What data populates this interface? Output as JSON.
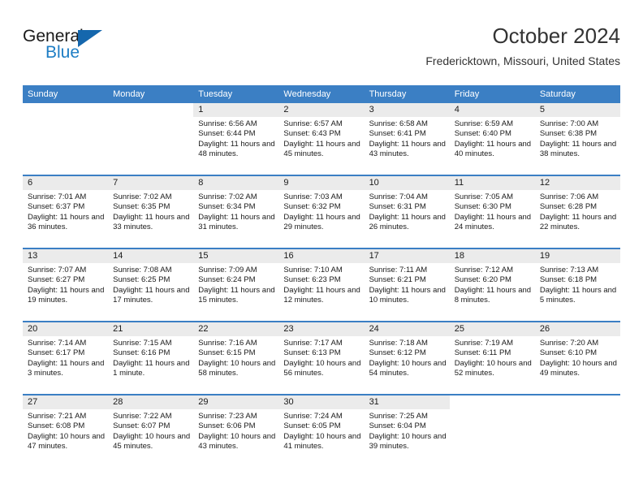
{
  "brand": {
    "name_top": "General",
    "name_bottom": "Blue",
    "triangle_icon": "triangle-icon",
    "accent_color": "#1567ad",
    "blue_text_color": "#1d7dc4"
  },
  "header": {
    "title": "October 2024",
    "subtitle": "Fredericktown, Missouri, United States"
  },
  "theme": {
    "header_row_bg": "#3b7fc4",
    "daynum_bg": "#ebebeb",
    "row_divider": "#3b7fc4",
    "text": "#1a1a1a"
  },
  "weekdays": [
    "Sunday",
    "Monday",
    "Tuesday",
    "Wednesday",
    "Thursday",
    "Friday",
    "Saturday"
  ],
  "weeks": [
    [
      {
        "day": "",
        "blank": true
      },
      {
        "day": "",
        "blank": true
      },
      {
        "day": "1",
        "sunrise": "Sunrise: 6:56 AM",
        "sunset": "Sunset: 6:44 PM",
        "daylight": "Daylight: 11 hours and 48 minutes."
      },
      {
        "day": "2",
        "sunrise": "Sunrise: 6:57 AM",
        "sunset": "Sunset: 6:43 PM",
        "daylight": "Daylight: 11 hours and 45 minutes."
      },
      {
        "day": "3",
        "sunrise": "Sunrise: 6:58 AM",
        "sunset": "Sunset: 6:41 PM",
        "daylight": "Daylight: 11 hours and 43 minutes."
      },
      {
        "day": "4",
        "sunrise": "Sunrise: 6:59 AM",
        "sunset": "Sunset: 6:40 PM",
        "daylight": "Daylight: 11 hours and 40 minutes."
      },
      {
        "day": "5",
        "sunrise": "Sunrise: 7:00 AM",
        "sunset": "Sunset: 6:38 PM",
        "daylight": "Daylight: 11 hours and 38 minutes."
      }
    ],
    [
      {
        "day": "6",
        "sunrise": "Sunrise: 7:01 AM",
        "sunset": "Sunset: 6:37 PM",
        "daylight": "Daylight: 11 hours and 36 minutes."
      },
      {
        "day": "7",
        "sunrise": "Sunrise: 7:02 AM",
        "sunset": "Sunset: 6:35 PM",
        "daylight": "Daylight: 11 hours and 33 minutes."
      },
      {
        "day": "8",
        "sunrise": "Sunrise: 7:02 AM",
        "sunset": "Sunset: 6:34 PM",
        "daylight": "Daylight: 11 hours and 31 minutes."
      },
      {
        "day": "9",
        "sunrise": "Sunrise: 7:03 AM",
        "sunset": "Sunset: 6:32 PM",
        "daylight": "Daylight: 11 hours and 29 minutes."
      },
      {
        "day": "10",
        "sunrise": "Sunrise: 7:04 AM",
        "sunset": "Sunset: 6:31 PM",
        "daylight": "Daylight: 11 hours and 26 minutes."
      },
      {
        "day": "11",
        "sunrise": "Sunrise: 7:05 AM",
        "sunset": "Sunset: 6:30 PM",
        "daylight": "Daylight: 11 hours and 24 minutes."
      },
      {
        "day": "12",
        "sunrise": "Sunrise: 7:06 AM",
        "sunset": "Sunset: 6:28 PM",
        "daylight": "Daylight: 11 hours and 22 minutes."
      }
    ],
    [
      {
        "day": "13",
        "sunrise": "Sunrise: 7:07 AM",
        "sunset": "Sunset: 6:27 PM",
        "daylight": "Daylight: 11 hours and 19 minutes."
      },
      {
        "day": "14",
        "sunrise": "Sunrise: 7:08 AM",
        "sunset": "Sunset: 6:25 PM",
        "daylight": "Daylight: 11 hours and 17 minutes."
      },
      {
        "day": "15",
        "sunrise": "Sunrise: 7:09 AM",
        "sunset": "Sunset: 6:24 PM",
        "daylight": "Daylight: 11 hours and 15 minutes."
      },
      {
        "day": "16",
        "sunrise": "Sunrise: 7:10 AM",
        "sunset": "Sunset: 6:23 PM",
        "daylight": "Daylight: 11 hours and 12 minutes."
      },
      {
        "day": "17",
        "sunrise": "Sunrise: 7:11 AM",
        "sunset": "Sunset: 6:21 PM",
        "daylight": "Daylight: 11 hours and 10 minutes."
      },
      {
        "day": "18",
        "sunrise": "Sunrise: 7:12 AM",
        "sunset": "Sunset: 6:20 PM",
        "daylight": "Daylight: 11 hours and 8 minutes."
      },
      {
        "day": "19",
        "sunrise": "Sunrise: 7:13 AM",
        "sunset": "Sunset: 6:18 PM",
        "daylight": "Daylight: 11 hours and 5 minutes."
      }
    ],
    [
      {
        "day": "20",
        "sunrise": "Sunrise: 7:14 AM",
        "sunset": "Sunset: 6:17 PM",
        "daylight": "Daylight: 11 hours and 3 minutes."
      },
      {
        "day": "21",
        "sunrise": "Sunrise: 7:15 AM",
        "sunset": "Sunset: 6:16 PM",
        "daylight": "Daylight: 11 hours and 1 minute."
      },
      {
        "day": "22",
        "sunrise": "Sunrise: 7:16 AM",
        "sunset": "Sunset: 6:15 PM",
        "daylight": "Daylight: 10 hours and 58 minutes."
      },
      {
        "day": "23",
        "sunrise": "Sunrise: 7:17 AM",
        "sunset": "Sunset: 6:13 PM",
        "daylight": "Daylight: 10 hours and 56 minutes."
      },
      {
        "day": "24",
        "sunrise": "Sunrise: 7:18 AM",
        "sunset": "Sunset: 6:12 PM",
        "daylight": "Daylight: 10 hours and 54 minutes."
      },
      {
        "day": "25",
        "sunrise": "Sunrise: 7:19 AM",
        "sunset": "Sunset: 6:11 PM",
        "daylight": "Daylight: 10 hours and 52 minutes."
      },
      {
        "day": "26",
        "sunrise": "Sunrise: 7:20 AM",
        "sunset": "Sunset: 6:10 PM",
        "daylight": "Daylight: 10 hours and 49 minutes."
      }
    ],
    [
      {
        "day": "27",
        "sunrise": "Sunrise: 7:21 AM",
        "sunset": "Sunset: 6:08 PM",
        "daylight": "Daylight: 10 hours and 47 minutes."
      },
      {
        "day": "28",
        "sunrise": "Sunrise: 7:22 AM",
        "sunset": "Sunset: 6:07 PM",
        "daylight": "Daylight: 10 hours and 45 minutes."
      },
      {
        "day": "29",
        "sunrise": "Sunrise: 7:23 AM",
        "sunset": "Sunset: 6:06 PM",
        "daylight": "Daylight: 10 hours and 43 minutes."
      },
      {
        "day": "30",
        "sunrise": "Sunrise: 7:24 AM",
        "sunset": "Sunset: 6:05 PM",
        "daylight": "Daylight: 10 hours and 41 minutes."
      },
      {
        "day": "31",
        "sunrise": "Sunrise: 7:25 AM",
        "sunset": "Sunset: 6:04 PM",
        "daylight": "Daylight: 10 hours and 39 minutes."
      },
      {
        "day": "",
        "blank": true
      },
      {
        "day": "",
        "blank": true
      }
    ]
  ]
}
